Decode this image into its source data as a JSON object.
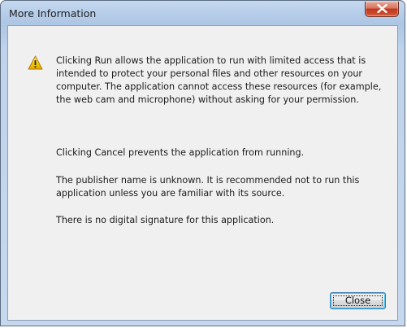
{
  "window": {
    "title": "More Information"
  },
  "content": {
    "icon": "warning-icon",
    "paragraphs": [
      "Clicking Run allows the application to run with limited access that is intended to protect your personal files and other resources on your computer. The application cannot access these resources (for example, the web cam and microphone) without asking for your permission.",
      "Clicking Cancel prevents the application from running.",
      "The publisher name is unknown. It is recommended not to run this application unless you are familiar with its source.",
      "There is no digital signature for this application."
    ]
  },
  "buttons": {
    "close_label": "Close"
  },
  "colors": {
    "frame": "#b8cfea",
    "client": "#f0f0f0",
    "close_button": "#c0391f",
    "button_focus": "#3c7fb1"
  }
}
